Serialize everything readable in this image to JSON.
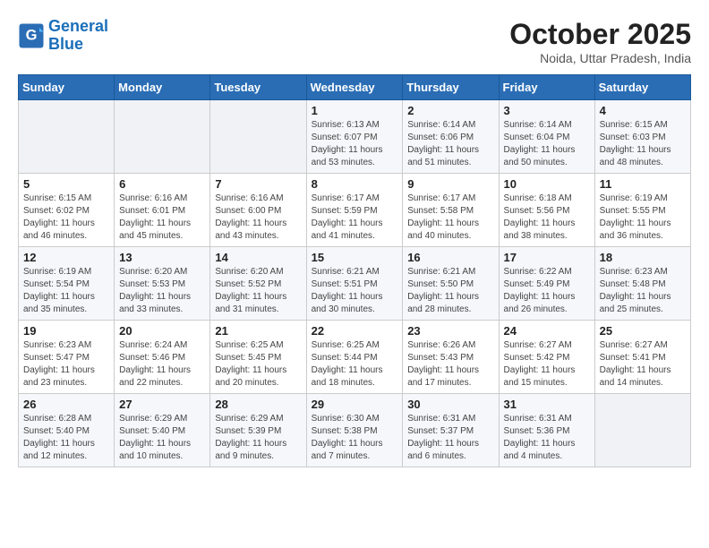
{
  "header": {
    "logo_line1": "General",
    "logo_line2": "Blue",
    "month": "October 2025",
    "location": "Noida, Uttar Pradesh, India"
  },
  "weekdays": [
    "Sunday",
    "Monday",
    "Tuesday",
    "Wednesday",
    "Thursday",
    "Friday",
    "Saturday"
  ],
  "weeks": [
    [
      {
        "num": "",
        "info": ""
      },
      {
        "num": "",
        "info": ""
      },
      {
        "num": "",
        "info": ""
      },
      {
        "num": "1",
        "info": "Sunrise: 6:13 AM\nSunset: 6:07 PM\nDaylight: 11 hours\nand 53 minutes."
      },
      {
        "num": "2",
        "info": "Sunrise: 6:14 AM\nSunset: 6:06 PM\nDaylight: 11 hours\nand 51 minutes."
      },
      {
        "num": "3",
        "info": "Sunrise: 6:14 AM\nSunset: 6:04 PM\nDaylight: 11 hours\nand 50 minutes."
      },
      {
        "num": "4",
        "info": "Sunrise: 6:15 AM\nSunset: 6:03 PM\nDaylight: 11 hours\nand 48 minutes."
      }
    ],
    [
      {
        "num": "5",
        "info": "Sunrise: 6:15 AM\nSunset: 6:02 PM\nDaylight: 11 hours\nand 46 minutes."
      },
      {
        "num": "6",
        "info": "Sunrise: 6:16 AM\nSunset: 6:01 PM\nDaylight: 11 hours\nand 45 minutes."
      },
      {
        "num": "7",
        "info": "Sunrise: 6:16 AM\nSunset: 6:00 PM\nDaylight: 11 hours\nand 43 minutes."
      },
      {
        "num": "8",
        "info": "Sunrise: 6:17 AM\nSunset: 5:59 PM\nDaylight: 11 hours\nand 41 minutes."
      },
      {
        "num": "9",
        "info": "Sunrise: 6:17 AM\nSunset: 5:58 PM\nDaylight: 11 hours\nand 40 minutes."
      },
      {
        "num": "10",
        "info": "Sunrise: 6:18 AM\nSunset: 5:56 PM\nDaylight: 11 hours\nand 38 minutes."
      },
      {
        "num": "11",
        "info": "Sunrise: 6:19 AM\nSunset: 5:55 PM\nDaylight: 11 hours\nand 36 minutes."
      }
    ],
    [
      {
        "num": "12",
        "info": "Sunrise: 6:19 AM\nSunset: 5:54 PM\nDaylight: 11 hours\nand 35 minutes."
      },
      {
        "num": "13",
        "info": "Sunrise: 6:20 AM\nSunset: 5:53 PM\nDaylight: 11 hours\nand 33 minutes."
      },
      {
        "num": "14",
        "info": "Sunrise: 6:20 AM\nSunset: 5:52 PM\nDaylight: 11 hours\nand 31 minutes."
      },
      {
        "num": "15",
        "info": "Sunrise: 6:21 AM\nSunset: 5:51 PM\nDaylight: 11 hours\nand 30 minutes."
      },
      {
        "num": "16",
        "info": "Sunrise: 6:21 AM\nSunset: 5:50 PM\nDaylight: 11 hours\nand 28 minutes."
      },
      {
        "num": "17",
        "info": "Sunrise: 6:22 AM\nSunset: 5:49 PM\nDaylight: 11 hours\nand 26 minutes."
      },
      {
        "num": "18",
        "info": "Sunrise: 6:23 AM\nSunset: 5:48 PM\nDaylight: 11 hours\nand 25 minutes."
      }
    ],
    [
      {
        "num": "19",
        "info": "Sunrise: 6:23 AM\nSunset: 5:47 PM\nDaylight: 11 hours\nand 23 minutes."
      },
      {
        "num": "20",
        "info": "Sunrise: 6:24 AM\nSunset: 5:46 PM\nDaylight: 11 hours\nand 22 minutes."
      },
      {
        "num": "21",
        "info": "Sunrise: 6:25 AM\nSunset: 5:45 PM\nDaylight: 11 hours\nand 20 minutes."
      },
      {
        "num": "22",
        "info": "Sunrise: 6:25 AM\nSunset: 5:44 PM\nDaylight: 11 hours\nand 18 minutes."
      },
      {
        "num": "23",
        "info": "Sunrise: 6:26 AM\nSunset: 5:43 PM\nDaylight: 11 hours\nand 17 minutes."
      },
      {
        "num": "24",
        "info": "Sunrise: 6:27 AM\nSunset: 5:42 PM\nDaylight: 11 hours\nand 15 minutes."
      },
      {
        "num": "25",
        "info": "Sunrise: 6:27 AM\nSunset: 5:41 PM\nDaylight: 11 hours\nand 14 minutes."
      }
    ],
    [
      {
        "num": "26",
        "info": "Sunrise: 6:28 AM\nSunset: 5:40 PM\nDaylight: 11 hours\nand 12 minutes."
      },
      {
        "num": "27",
        "info": "Sunrise: 6:29 AM\nSunset: 5:40 PM\nDaylight: 11 hours\nand 10 minutes."
      },
      {
        "num": "28",
        "info": "Sunrise: 6:29 AM\nSunset: 5:39 PM\nDaylight: 11 hours\nand 9 minutes."
      },
      {
        "num": "29",
        "info": "Sunrise: 6:30 AM\nSunset: 5:38 PM\nDaylight: 11 hours\nand 7 minutes."
      },
      {
        "num": "30",
        "info": "Sunrise: 6:31 AM\nSunset: 5:37 PM\nDaylight: 11 hours\nand 6 minutes."
      },
      {
        "num": "31",
        "info": "Sunrise: 6:31 AM\nSunset: 5:36 PM\nDaylight: 11 hours\nand 4 minutes."
      },
      {
        "num": "",
        "info": ""
      }
    ]
  ]
}
